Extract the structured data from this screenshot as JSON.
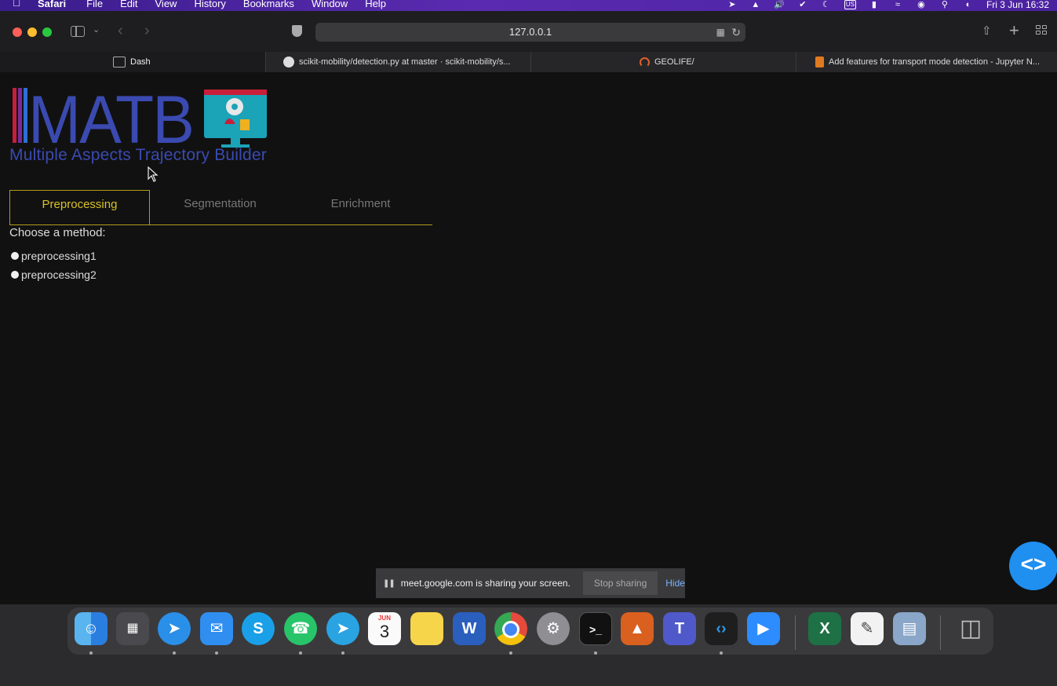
{
  "menubar": {
    "app_name": "Safari",
    "items": [
      "File",
      "Edit",
      "View",
      "History",
      "Bookmarks",
      "Window",
      "Help"
    ],
    "clock": "Fri 3 Jun  16:32",
    "keyboard_layout": "US"
  },
  "toolbar": {
    "url": "127.0.0.1"
  },
  "tabs": [
    {
      "label": "Dash",
      "active": true
    },
    {
      "label": "scikit-mobility/detection.py at master · scikit-mobility/s...",
      "active": false
    },
    {
      "label": "GEOLIFE/",
      "active": false
    },
    {
      "label": "Add features for transport mode detection - Jupyter N...",
      "active": false
    }
  ],
  "page": {
    "logo_text": "MATB",
    "logo_caption": "Multiple Aspects Trajectory Builder",
    "nav_tabs": [
      {
        "label": "Preprocessing",
        "active": true
      },
      {
        "label": "Segmentation",
        "active": false
      },
      {
        "label": "Enrichment",
        "active": false
      }
    ],
    "choose_label": "Choose a method:",
    "methods": [
      "preprocessing1",
      "preprocessing2"
    ]
  },
  "share_banner": {
    "message": "meet.google.com is sharing your screen.",
    "stop_label": "Stop sharing",
    "hide_label": "Hide"
  },
  "dock": {
    "calendar_month": "JUN",
    "calendar_day": "3",
    "items": [
      "finder-icon",
      "launchpad-icon",
      "safari-icon",
      "mail-icon",
      "skype-icon",
      "whatsapp-icon",
      "telegram-icon",
      "calendar-icon",
      "notes-icon",
      "word-icon",
      "chrome-icon",
      "system-preferences-icon",
      "terminal-icon",
      "matlab-icon",
      "teams-icon",
      "vscode-icon",
      "zoom-icon",
      "excel-icon",
      "textedit-icon",
      "preview-icon",
      "trash-icon"
    ]
  },
  "colors": {
    "accent_gold": "#b39a1e",
    "active_tab_text": "#d8c22a",
    "logo_blue": "#3a4ab0",
    "fab_blue": "#1f8ff0"
  }
}
